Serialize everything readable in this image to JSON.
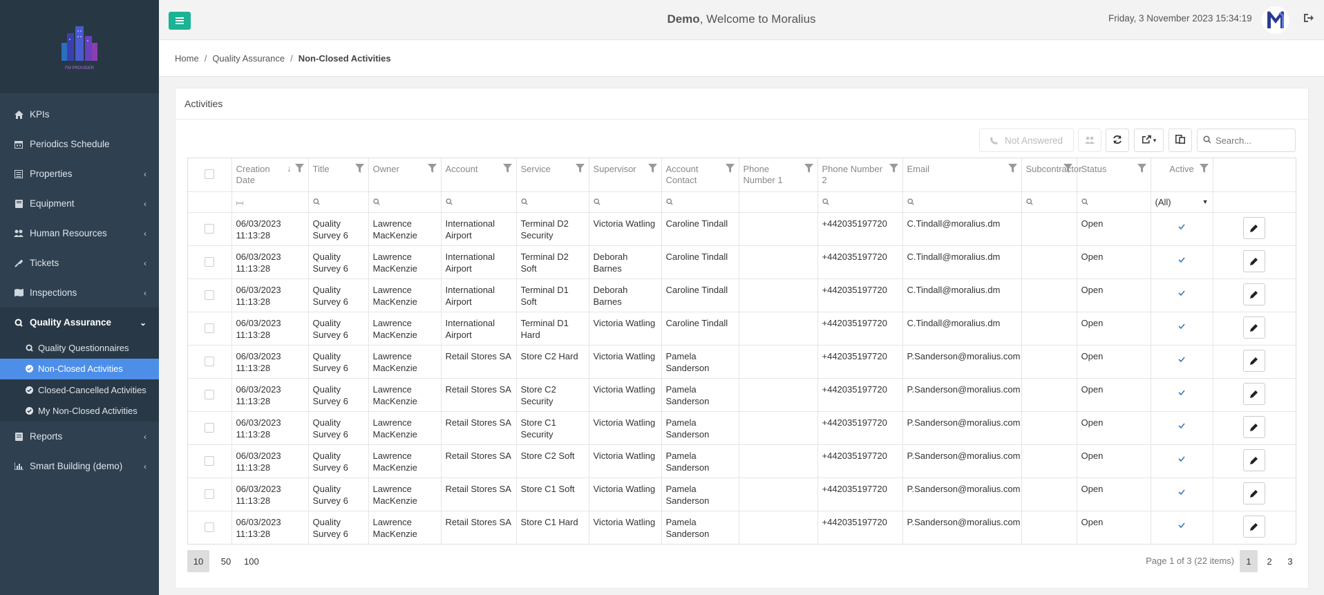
{
  "sidebar": {
    "logo_text": "FM PROVIDER",
    "items": [
      {
        "label": "KPIs",
        "icon": "home-icon",
        "chev": false
      },
      {
        "label": "Periodics Schedule",
        "icon": "calendar-icon",
        "chev": false
      },
      {
        "label": "Properties",
        "icon": "building-icon",
        "chev": true
      },
      {
        "label": "Equipment",
        "icon": "book-icon",
        "chev": true
      },
      {
        "label": "Human Resources",
        "icon": "users-icon",
        "chev": true
      },
      {
        "label": "Tickets",
        "icon": "wrench-icon",
        "chev": true
      },
      {
        "label": "Inspections",
        "icon": "map-icon",
        "chev": true
      },
      {
        "label": "Quality Assurance",
        "icon": "q-icon",
        "chev": true
      },
      {
        "label": "Reports",
        "icon": "report-icon",
        "chev": true
      },
      {
        "label": "Smart Building (demo)",
        "icon": "chart-icon",
        "chev": true
      }
    ],
    "qa_sub": [
      {
        "label": "Quality Questionnaires"
      },
      {
        "label": "Non-Closed Activities"
      },
      {
        "label": "Closed-Cancelled Activities"
      },
      {
        "label": "My Non-Closed Activities"
      }
    ]
  },
  "header": {
    "user": "Demo",
    "welcome": ", Welcome to Moralius",
    "datetime": "Friday, 3 November 2023 15:34:19"
  },
  "breadcrumb": {
    "home": "Home",
    "section": "Quality Assurance",
    "current": "Non-Closed Activities"
  },
  "panel": {
    "title": "Activities"
  },
  "toolbar": {
    "not_answered": "Not Answered",
    "search_placeholder": "Search..."
  },
  "columns": [
    "Creation Date",
    "Title",
    "Owner",
    "Account",
    "Service",
    "Supervisor",
    "Account Contact",
    "Phone Number 1",
    "Phone Number 2",
    "Email",
    "Subcontractor",
    "Status",
    "Active"
  ],
  "active_filter": "(All)",
  "rows": [
    {
      "date": "06/03/2023 11:13:28",
      "title": "Quality Survey 6",
      "owner": "Lawrence MacKenzie",
      "account": "International Airport",
      "service": "Terminal D2 Security",
      "supervisor": "Victoria Watling",
      "contact": "Caroline Tindall",
      "phone1": "",
      "phone2": "+442035197720",
      "email": "C.Tindall@moralius.dm",
      "sub": "",
      "status": "Open"
    },
    {
      "date": "06/03/2023 11:13:28",
      "title": "Quality Survey 6",
      "owner": "Lawrence MacKenzie",
      "account": "International Airport",
      "service": "Terminal D2 Soft",
      "supervisor": "Deborah Barnes",
      "contact": "Caroline Tindall",
      "phone1": "",
      "phone2": "+442035197720",
      "email": "C.Tindall@moralius.dm",
      "sub": "",
      "status": "Open"
    },
    {
      "date": "06/03/2023 11:13:28",
      "title": "Quality Survey 6",
      "owner": "Lawrence MacKenzie",
      "account": "International Airport",
      "service": "Terminal D1 Soft",
      "supervisor": "Deborah Barnes",
      "contact": "Caroline Tindall",
      "phone1": "",
      "phone2": "+442035197720",
      "email": "C.Tindall@moralius.dm",
      "sub": "",
      "status": "Open"
    },
    {
      "date": "06/03/2023 11:13:28",
      "title": "Quality Survey 6",
      "owner": "Lawrence MacKenzie",
      "account": "International Airport",
      "service": "Terminal D1 Hard",
      "supervisor": "Victoria Watling",
      "contact": "Caroline Tindall",
      "phone1": "",
      "phone2": "+442035197720",
      "email": "C.Tindall@moralius.dm",
      "sub": "",
      "status": "Open"
    },
    {
      "date": "06/03/2023 11:13:28",
      "title": "Quality Survey 6",
      "owner": "Lawrence MacKenzie",
      "account": "Retail Stores SA",
      "service": "Store C2 Hard",
      "supervisor": "Victoria Watling",
      "contact": "Pamela Sanderson",
      "phone1": "",
      "phone2": "+442035197720",
      "email": "P.Sanderson@moralius.com",
      "sub": "",
      "status": "Open"
    },
    {
      "date": "06/03/2023 11:13:28",
      "title": "Quality Survey 6",
      "owner": "Lawrence MacKenzie",
      "account": "Retail Stores SA",
      "service": "Store C2 Security",
      "supervisor": "Victoria Watling",
      "contact": "Pamela Sanderson",
      "phone1": "",
      "phone2": "+442035197720",
      "email": "P.Sanderson@moralius.com",
      "sub": "",
      "status": "Open"
    },
    {
      "date": "06/03/2023 11:13:28",
      "title": "Quality Survey 6",
      "owner": "Lawrence MacKenzie",
      "account": "Retail Stores SA",
      "service": "Store C1 Security",
      "supervisor": "Victoria Watling",
      "contact": "Pamela Sanderson",
      "phone1": "",
      "phone2": "+442035197720",
      "email": "P.Sanderson@moralius.com",
      "sub": "",
      "status": "Open"
    },
    {
      "date": "06/03/2023 11:13:28",
      "title": "Quality Survey 6",
      "owner": "Lawrence MacKenzie",
      "account": "Retail Stores SA",
      "service": "Store C2 Soft",
      "supervisor": "Victoria Watling",
      "contact": "Pamela Sanderson",
      "phone1": "",
      "phone2": "+442035197720",
      "email": "P.Sanderson@moralius.com",
      "sub": "",
      "status": "Open"
    },
    {
      "date": "06/03/2023 11:13:28",
      "title": "Quality Survey 6",
      "owner": "Lawrence MacKenzie",
      "account": "Retail Stores SA",
      "service": "Store C1 Soft",
      "supervisor": "Victoria Watling",
      "contact": "Pamela Sanderson",
      "phone1": "",
      "phone2": "+442035197720",
      "email": "P.Sanderson@moralius.com",
      "sub": "",
      "status": "Open"
    },
    {
      "date": "06/03/2023 11:13:28",
      "title": "Quality Survey 6",
      "owner": "Lawrence MacKenzie",
      "account": "Retail Stores SA",
      "service": "Store C1 Hard",
      "supervisor": "Victoria Watling",
      "contact": "Pamela Sanderson",
      "phone1": "",
      "phone2": "+442035197720",
      "email": "P.Sanderson@moralius.com",
      "sub": "",
      "status": "Open"
    }
  ],
  "pager": {
    "sizes": [
      "10",
      "50",
      "100"
    ],
    "info": "Page 1 of 3 (22 items)",
    "pages": [
      "1",
      "2",
      "3"
    ]
  },
  "colors": {
    "accent": "#1ab394",
    "sidebar": "#2f4050",
    "selected": "#4d8fe8",
    "link": "#337ab7"
  }
}
